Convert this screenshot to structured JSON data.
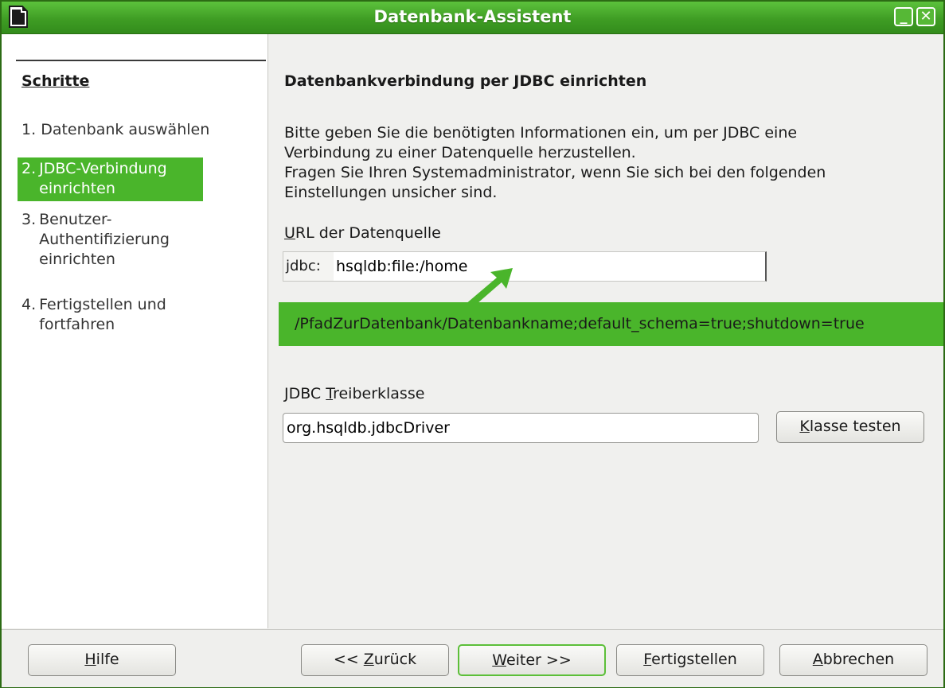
{
  "window": {
    "title": "Datenbank-Assistent",
    "minimize_glyph": "_",
    "close_glyph": "✕"
  },
  "sidebar": {
    "heading": "Schritte",
    "steps": [
      {
        "num": "1.",
        "label": "Datenbank auswählen",
        "active": false
      },
      {
        "num": "2.",
        "label": "JDBC-Verbindung einrichten",
        "active": true
      },
      {
        "num": "3.",
        "label": "Benutzer-Authentifizierung einrichten",
        "active": false
      },
      {
        "num": "4.",
        "label": "Fertigstellen und fortfahren",
        "active": false
      }
    ]
  },
  "main": {
    "title": "Datenbankverbindung per JDBC einrichten",
    "intro_line1": "Bitte geben Sie die benötigten Informationen ein, um per JDBC eine",
    "intro_line2": "Verbindung zu einer Datenquelle herzustellen.",
    "intro_line3": "Fragen Sie Ihren Systemadministrator, wenn Sie sich bei den folgenden",
    "intro_line4": "Einstellungen unsicher sind.",
    "url_label_mnemonic": "U",
    "url_label_rest": "RL der Datenquelle",
    "url_prefix": "jdbc:",
    "url_value": "hsqldb:file:/home",
    "callout_text": "/PfadZurDatenbank/Datenbankname;default_schema=true;shutdown=true",
    "driver_label_pre": "JDBC ",
    "driver_label_mnemonic": "T",
    "driver_label_rest": "reiberklasse",
    "driver_value": "org.hsqldb.jdbcDriver",
    "test_button_mnemonic": "K",
    "test_button_rest": "lasse testen"
  },
  "footer": {
    "help": {
      "mnemonic": "H",
      "rest": "ilfe"
    },
    "back": {
      "pre": "<< ",
      "mnemonic": "Z",
      "rest": "urück"
    },
    "next": {
      "mnemonic": "W",
      "rest": "eiter >>"
    },
    "finish": {
      "mnemonic": "F",
      "rest": "ertigstellen"
    },
    "cancel": {
      "mnemonic": "A",
      "rest": "bbrechen"
    }
  },
  "colors": {
    "accent_green": "#4ab52b",
    "titlebar_green": "#3f9d24"
  }
}
